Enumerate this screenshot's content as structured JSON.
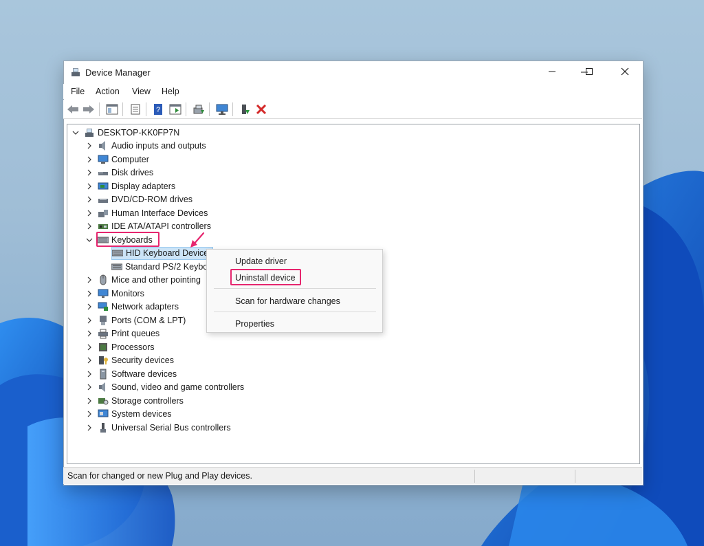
{
  "window": {
    "title": "Device Manager",
    "controls": [
      "minimize",
      "maximize",
      "close"
    ]
  },
  "menubar": {
    "items": [
      "File",
      "Action",
      "View",
      "Help"
    ]
  },
  "toolbar": {
    "buttons": [
      "back-icon",
      "forward-icon",
      "show-hide-console-tree-icon",
      "properties-icon",
      "help-icon",
      "action-pane-icon",
      "update-driver-icon",
      "scan-hardware-icon",
      "enable-device-icon",
      "uninstall-device-icon"
    ]
  },
  "tree": {
    "root": "DESKTOP-KK0FP7N",
    "categories": [
      {
        "label": "Audio inputs and outputs",
        "icon": "speaker-icon"
      },
      {
        "label": "Computer",
        "icon": "computer-icon"
      },
      {
        "label": "Disk drives",
        "icon": "disk-drive-icon"
      },
      {
        "label": "Display adapters",
        "icon": "display-adapter-icon"
      },
      {
        "label": "DVD/CD-ROM drives",
        "icon": "dvd-drive-icon"
      },
      {
        "label": "Human Interface Devices",
        "icon": "hid-icon"
      },
      {
        "label": "IDE ATA/ATAPI controllers",
        "icon": "ide-controller-icon"
      },
      {
        "label": "Keyboards",
        "icon": "keyboard-icon",
        "expanded": true,
        "children": [
          {
            "label": "HID Keyboard Device",
            "selected": true
          },
          {
            "label": "Standard PS/2 Keybo"
          }
        ]
      },
      {
        "label": "Mice and other pointing",
        "icon": "mouse-icon"
      },
      {
        "label": "Monitors",
        "icon": "monitor-icon"
      },
      {
        "label": "Network adapters",
        "icon": "network-adapter-icon"
      },
      {
        "label": "Ports (COM & LPT)",
        "icon": "port-icon"
      },
      {
        "label": "Print queues",
        "icon": "printer-icon"
      },
      {
        "label": "Processors",
        "icon": "processor-icon"
      },
      {
        "label": "Security devices",
        "icon": "security-device-icon"
      },
      {
        "label": "Software devices",
        "icon": "software-device-icon"
      },
      {
        "label": "Sound, video and game controllers",
        "icon": "sound-icon"
      },
      {
        "label": "Storage controllers",
        "icon": "storage-controller-icon"
      },
      {
        "label": "System devices",
        "icon": "system-device-icon"
      },
      {
        "label": "Universal Serial Bus controllers",
        "icon": "usb-icon"
      }
    ]
  },
  "context_menu": {
    "items": [
      "Update driver",
      "Uninstall device",
      "Scan for hardware changes",
      "Properties"
    ],
    "highlighted": "Uninstall device"
  },
  "statusbar": {
    "text": "Scan for changed or new Plug and Play devices."
  },
  "colors": {
    "highlight": "#e6266e",
    "selection": "#cce4f7",
    "wallpaper_blue": "#1d6fd6"
  }
}
